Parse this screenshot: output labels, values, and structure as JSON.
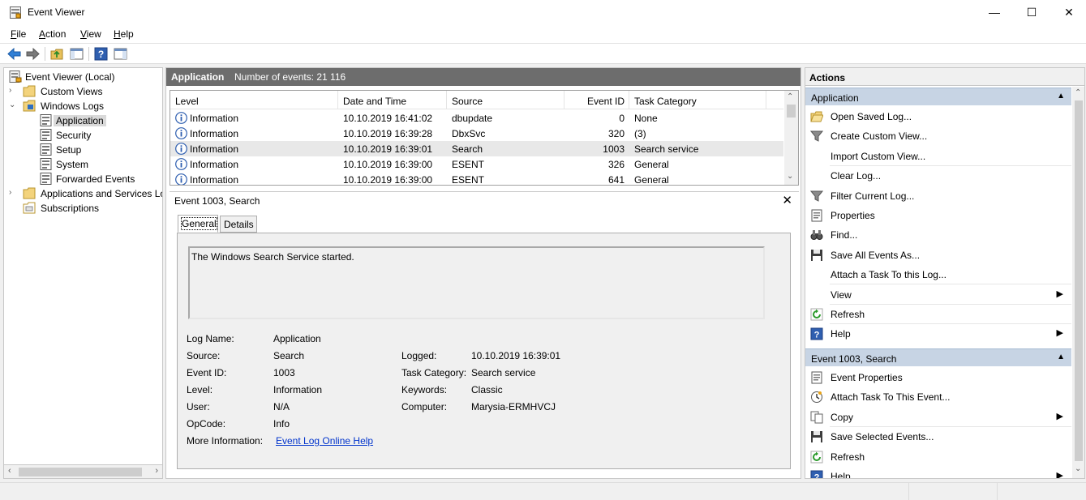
{
  "window": {
    "title": "Event Viewer",
    "min_glyph": "—",
    "max_glyph": "☐",
    "close_glyph": "✕"
  },
  "menu": [
    {
      "label": "File",
      "key": "F",
      "rest": "ile"
    },
    {
      "label": "Action",
      "key": "A",
      "rest": "ction"
    },
    {
      "label": "View",
      "key": "V",
      "rest": "iew"
    },
    {
      "label": "Help",
      "key": "H",
      "rest": "elp"
    }
  ],
  "tree": {
    "root": "Event Viewer (Local)",
    "custom_views": "Custom Views",
    "windows_logs": "Windows Logs",
    "application": "Application",
    "security": "Security",
    "setup": "Setup",
    "system": "System",
    "forwarded": "Forwarded Events",
    "apps_services": "Applications and Services Lo",
    "subscriptions": "Subscriptions"
  },
  "center": {
    "log_name": "Application",
    "event_count": "Number of events: 21 116",
    "columns": [
      "Level",
      "Date and Time",
      "Source",
      "Event ID",
      "Task Category"
    ],
    "rows": [
      {
        "level": "Information",
        "datetime": "10.10.2019 16:41:02",
        "source": "dbupdate",
        "event_id": "0",
        "task": "None"
      },
      {
        "level": "Information",
        "datetime": "10.10.2019 16:39:28",
        "source": "DbxSvc",
        "event_id": "320",
        "task": "(3)"
      },
      {
        "level": "Information",
        "datetime": "10.10.2019 16:39:01",
        "source": "Search",
        "event_id": "1003",
        "task": "Search service"
      },
      {
        "level": "Information",
        "datetime": "10.10.2019 16:39:00",
        "source": "ESENT",
        "event_id": "326",
        "task": "General"
      },
      {
        "level": "Information",
        "datetime": "10.10.2019 16:39:00",
        "source": "ESENT",
        "event_id": "641",
        "task": "General"
      }
    ],
    "selected_row": 2
  },
  "detail": {
    "title": "Event 1003, Search",
    "close_glyph": "✕",
    "tabs": [
      "General",
      "Details"
    ],
    "description": "The Windows Search Service started.",
    "labels": {
      "log_name": "Log Name:",
      "source": "Source:",
      "event_id": "Event ID:",
      "level": "Level:",
      "user": "User:",
      "opcode": "OpCode:",
      "more_info": "More Information:",
      "logged": "Logged:",
      "task_category": "Task Category:",
      "keywords": "Keywords:",
      "computer": "Computer:"
    },
    "values": {
      "log_name": "Application",
      "source": "Search",
      "event_id": "1003",
      "level": "Information",
      "user": "N/A",
      "opcode": "Info",
      "more_info_link": "Event Log Online Help",
      "logged": "10.10.2019 16:39:01",
      "task_category": "Search service",
      "keywords": "Classic",
      "computer": "Marysia-ERMHVCJ"
    }
  },
  "actions": {
    "title": "Actions",
    "section1": "Application",
    "section1_items": [
      {
        "label": "Open Saved Log...",
        "icon": "folder-open-icon",
        "submenu": false
      },
      {
        "label": "Create Custom View...",
        "icon": "filter-icon",
        "submenu": false
      },
      {
        "label": "Import Custom View...",
        "icon": "none",
        "submenu": false
      },
      {
        "label": "Clear Log...",
        "icon": "none",
        "submenu": false
      },
      {
        "label": "Filter Current Log...",
        "icon": "filter-icon",
        "submenu": false
      },
      {
        "label": "Properties",
        "icon": "properties-icon",
        "submenu": false
      },
      {
        "label": "Find...",
        "icon": "binoculars-icon",
        "submenu": false
      },
      {
        "label": "Save All Events As...",
        "icon": "save-icon",
        "submenu": false
      },
      {
        "label": "Attach a Task To this Log...",
        "icon": "none",
        "submenu": false
      },
      {
        "label": "View",
        "icon": "none",
        "submenu": true
      },
      {
        "label": "Refresh",
        "icon": "refresh-icon",
        "submenu": false
      },
      {
        "label": "Help",
        "icon": "help-icon",
        "submenu": true
      }
    ],
    "section2": "Event 1003, Search",
    "section2_items": [
      {
        "label": "Event Properties",
        "icon": "properties-icon",
        "submenu": false
      },
      {
        "label": "Attach Task To This Event...",
        "icon": "task-icon",
        "submenu": false
      },
      {
        "label": "Copy",
        "icon": "copy-icon",
        "submenu": true
      },
      {
        "label": "Save Selected Events...",
        "icon": "save-icon",
        "submenu": false
      },
      {
        "label": "Refresh",
        "icon": "refresh-icon",
        "submenu": false
      },
      {
        "label": "Help",
        "icon": "help-icon",
        "submenu": true
      }
    ]
  },
  "colors": {
    "section_header": "#c7d4e4",
    "center_header": "#6d6d6d",
    "link": "#0033cc"
  }
}
